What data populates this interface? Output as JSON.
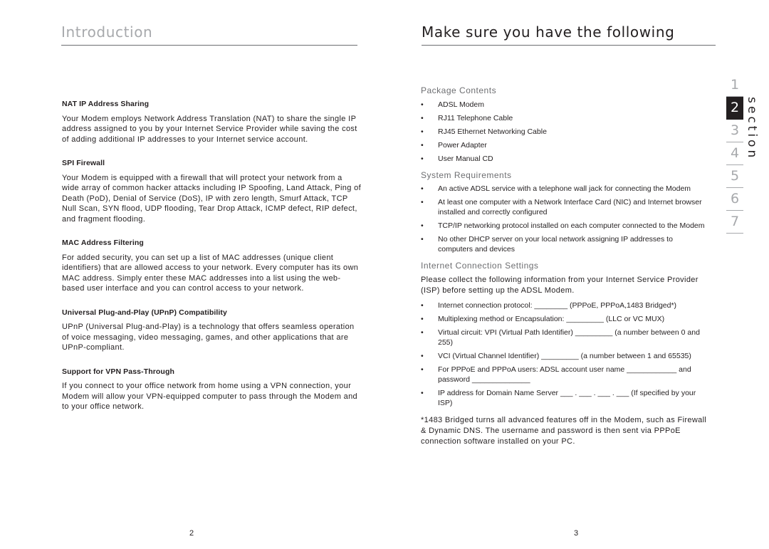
{
  "left_page": {
    "title": "Introduction",
    "sections": [
      {
        "heading": "NAT IP Address Sharing",
        "body": "Your Modem employs Network Address Translation (NAT) to share the single IP address assigned to you by your Internet Service Provider while saving the cost of adding additional IP addresses to your Internet service account."
      },
      {
        "heading": "SPI Firewall",
        "body": "Your Modem is equipped with a firewall that will protect your network from a wide array of common hacker attacks including IP Spoofing, Land Attack, Ping of Death (PoD), Denial of Service (DoS), IP with zero length, Smurf Attack, TCP Null Scan, SYN flood, UDP flooding, Tear Drop Attack, ICMP defect, RIP defect, and fragment flooding."
      },
      {
        "heading": "MAC Address Filtering",
        "body": "For added security, you can set up a list of MAC addresses (unique client identifiers) that are allowed access to your network. Every computer has its own MAC address. Simply enter these MAC addresses into a list using the web-based user interface and you can control access to your network."
      },
      {
        "heading": "Universal Plug-and-Play (UPnP) Compatibility",
        "body": "UPnP (Universal Plug-and-Play) is a technology that offers seamless operation of voice messaging, video messaging, games, and other applications that are UPnP-compliant."
      },
      {
        "heading": "Support for VPN Pass-Through",
        "body": "If you connect to your office network from home using a VPN connection, your Modem will allow your VPN-equipped computer to pass through the Modem and to your office network."
      }
    ],
    "page_number": "2"
  },
  "right_page": {
    "title": "Make sure you have the following",
    "package_contents": {
      "heading": "Package Contents",
      "items": [
        "ADSL Modem",
        "RJ11 Telephone Cable",
        "RJ45 Ethernet Networking Cable",
        "Power Adapter",
        "User Manual CD"
      ]
    },
    "system_requirements": {
      "heading": "System Requirements",
      "items": [
        "An active ADSL service with a telephone wall jack for connecting the Modem",
        "At least one computer with a Network Interface Card (NIC) and Internet browser installed and correctly configured",
        "TCP/IP networking protocol installed on each computer connected to the Modem",
        "No other DHCP server on your local network assigning IP addresses to computers and devices"
      ]
    },
    "internet_settings": {
      "heading": "Internet Connection Settings",
      "intro": "Please collect the following information from your Internet Service Provider (ISP) before setting up the ADSL Modem.",
      "items": [
        "Internet connection protocol: ________ (PPPoE, PPPoA,1483 Bridged*)",
        "Multiplexing method or Encapsulation: _________ (LLC or VC MUX)",
        "Virtual circuit: VPI (Virtual Path Identifier) _________ (a number between 0 and 255)",
        "VCI (Virtual Channel Identifier) _________ (a number between 1 and 65535)",
        "For PPPoE and PPPoA users: ADSL account user name ____________ and password ______________",
        "IP address for Domain Name Server ___ . ___ . ___ . ___ (If specified by your ISP)"
      ],
      "footnote": "*1483 Bridged turns all advanced features off in the Modem, such as Firewall & Dynamic DNS. The username and password is then sent via PPPoE connection software installed on your PC."
    },
    "page_number": "3"
  },
  "section_nav": {
    "label": "section",
    "tabs": [
      "1",
      "2",
      "3",
      "4",
      "5",
      "6",
      "7"
    ],
    "active": "2"
  },
  "bullet_glyph": "•"
}
